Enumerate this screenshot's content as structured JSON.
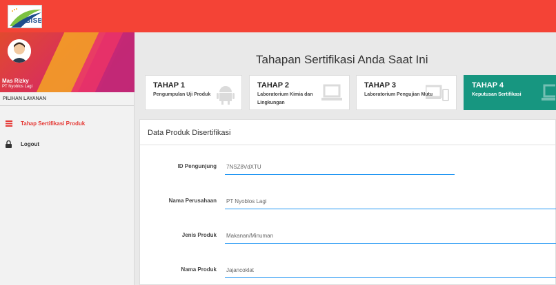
{
  "app": {
    "logo_text": "BISBY"
  },
  "colors": {
    "topbar": "#f44336",
    "active_stage": "#179680",
    "accent_red": "#e53935",
    "field_underline": "#2196f3"
  },
  "sidebar": {
    "user_name": "Mas Rizky",
    "user_company": "PT Nyoblos Lagi",
    "section_label": "PILIHAN LAYANAN",
    "items": [
      {
        "label": "Tahap Sertifikasi Produk",
        "icon": "list-icon",
        "active": true
      },
      {
        "label": "Logout",
        "icon": "lock-icon",
        "active": false
      }
    ]
  },
  "main": {
    "title": "Tahapan Sertifikasi Anda Saat Ini",
    "stages": [
      {
        "title": "TAHAP 1",
        "desc": "Pengumpulan Uji Produk",
        "icon": "android-icon",
        "active": false
      },
      {
        "title": "TAHAP 2",
        "desc": "Laboratorium Kimia dan Lingkungan",
        "icon": "laptop-icon",
        "active": false
      },
      {
        "title": "TAHAP 3",
        "desc": "Laboratorium Pengujian Mutu",
        "icon": "devices-icon",
        "active": false
      },
      {
        "title": "TAHAP 4",
        "desc": "Keputusan Sertifikasi",
        "icon": "laptop-icon",
        "active": true
      }
    ],
    "card": {
      "title": "Data Produk Disertifikasi",
      "fields": [
        {
          "label": "ID Pengunjung",
          "value": "7NSZ8VdXTU"
        },
        {
          "label": "Nama Perusahaan",
          "value": "PT Nyoblos Lagi"
        },
        {
          "label": "Jenis Produk",
          "value": "Makanan/Minuman"
        },
        {
          "label": "Nama Produk",
          "value": "Jajancoklat"
        }
      ]
    }
  }
}
